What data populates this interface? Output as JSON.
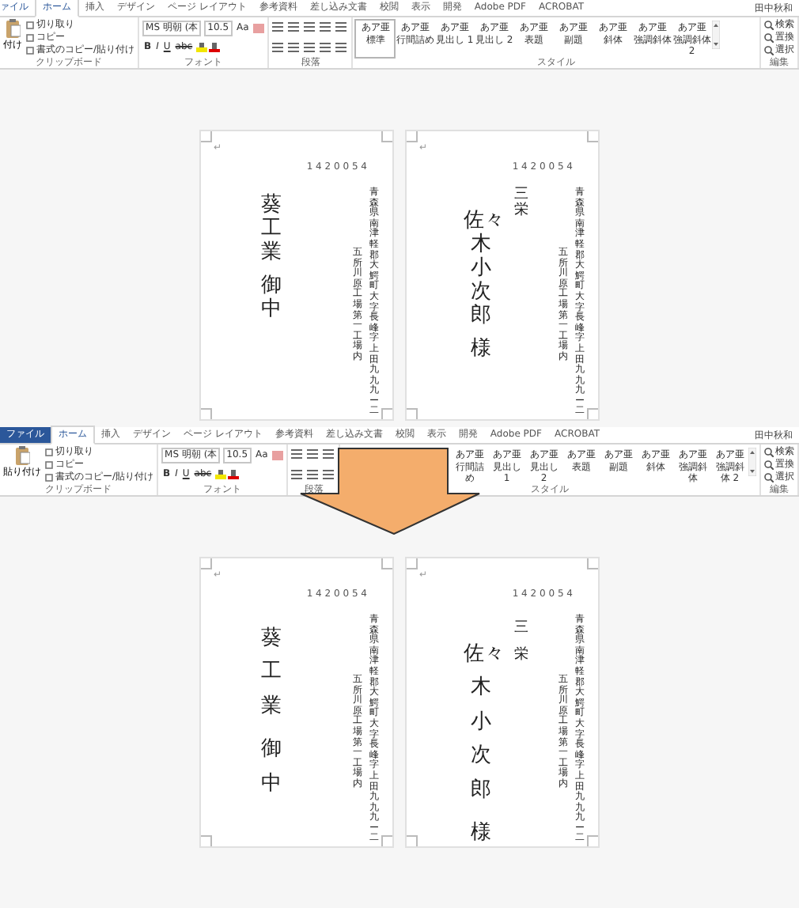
{
  "screens": [
    {
      "ribbon": {
        "tabs": [
          {
            "label": "ァイル",
            "kind": "file",
            "selected": false
          },
          {
            "label": "ホーム",
            "kind": "tab",
            "selected": true
          },
          {
            "label": "挿入",
            "kind": "tab",
            "selected": false
          },
          {
            "label": "デザイン",
            "kind": "tab",
            "selected": false
          },
          {
            "label": "ページ レイアウト",
            "kind": "tab",
            "selected": false
          },
          {
            "label": "参考資料",
            "kind": "tab",
            "selected": false
          },
          {
            "label": "差し込み文書",
            "kind": "tab",
            "selected": false
          },
          {
            "label": "校閲",
            "kind": "tab",
            "selected": false
          },
          {
            "label": "表示",
            "kind": "tab",
            "selected": false
          },
          {
            "label": "開発",
            "kind": "tab",
            "selected": false
          },
          {
            "label": "Adobe PDF",
            "kind": "tab",
            "selected": false
          },
          {
            "label": "ACROBAT",
            "kind": "tab",
            "selected": false
          }
        ],
        "user": "田中秋和",
        "groups": [
          {
            "kind": "clipboard",
            "label": "クリップボード",
            "paste": "付け",
            "items": [
              "切り取り",
              "コピー",
              "書式のコピー/貼り付け"
            ]
          },
          {
            "kind": "font",
            "label": "フォント",
            "font": "MS 明朝 (本",
            "size": "10.5",
            "case": "Aa",
            "formats": [
              "B",
              "I",
              "U",
              "abc"
            ]
          },
          {
            "kind": "paragraph",
            "label": "段落"
          },
          {
            "kind": "styles",
            "label": "スタイル",
            "items": [
              {
                "preview": "あア亜",
                "name": "標準",
                "selected": true
              },
              {
                "preview": "あア亜",
                "name": "行間詰め",
                "selected": false
              },
              {
                "preview": "あア亜",
                "name": "見出し 1",
                "selected": false
              },
              {
                "preview": "あア亜",
                "name": "見出し 2",
                "selected": false
              },
              {
                "preview": "あア亜",
                "name": "表題",
                "selected": false
              },
              {
                "preview": "あア亜",
                "name": "副題",
                "selected": false
              },
              {
                "preview": "あア亜",
                "name": "斜体",
                "selected": false
              },
              {
                "preview": "あア亜",
                "name": "強調斜体",
                "selected": false
              },
              {
                "preview": "あア亜",
                "name": "強調斜体 2",
                "selected": false
              }
            ]
          },
          {
            "kind": "editing",
            "label": "編集",
            "items": [
              "検索",
              "置換",
              "選択"
            ]
          }
        ]
      },
      "pages": [
        {
          "mark": "↵",
          "postal": "1 4 2 0 0 5 4",
          "recipient": {
            "name": "葵工業",
            "honorific": "御中"
          },
          "address": [
            "五所川原工場第一工場内",
            "青森県南津軽郡大鰐町大字長峰字上田九九九ー二"
          ],
          "spaced": false
        },
        {
          "mark": "↵",
          "postal": "1 4 2 0 0 5 4",
          "recipient": {
            "name": "佐々木小次郎",
            "honorific": "様"
          },
          "company": "三栄",
          "address": [
            "五所川原工場第一工場内",
            "青森県南津軽郡大鰐町大字長峰字上田九九九ー二"
          ],
          "spaced": false
        }
      ]
    },
    {
      "ribbon": {
        "tabs": [
          {
            "label": "ファイル",
            "kind": "file",
            "selected": false
          },
          {
            "label": "ホーム",
            "kind": "tab",
            "selected": true
          },
          {
            "label": "挿入",
            "kind": "tab",
            "selected": false
          },
          {
            "label": "デザイン",
            "kind": "tab",
            "selected": false
          },
          {
            "label": "ページ レイアウト",
            "kind": "tab",
            "selected": false
          },
          {
            "label": "参考資料",
            "kind": "tab",
            "selected": false
          },
          {
            "label": "差し込み文書",
            "kind": "tab",
            "selected": false
          },
          {
            "label": "校閲",
            "kind": "tab",
            "selected": false
          },
          {
            "label": "表示",
            "kind": "tab",
            "selected": false
          },
          {
            "label": "開発",
            "kind": "tab",
            "selected": false
          },
          {
            "label": "Adobe PDF",
            "kind": "tab",
            "selected": false
          },
          {
            "label": "ACROBAT",
            "kind": "tab",
            "selected": false
          }
        ],
        "user": "田中秋和",
        "groups": [
          {
            "kind": "clipboard",
            "label": "クリップボード",
            "paste": "貼り付け",
            "items": [
              "切り取り",
              "コピー",
              "書式のコピー/貼り付け"
            ]
          },
          {
            "kind": "font",
            "label": "フォント",
            "font": "MS 明朝 (本",
            "size": "10.5",
            "case": "Aa",
            "formats": [
              "B",
              "I",
              "U",
              "abc"
            ]
          },
          {
            "kind": "paragraph",
            "label": "段落"
          },
          {
            "kind": "styles",
            "label": "スタイル",
            "items": [
              {
                "preview": "あア亜",
                "name": "行間詰め",
                "selected": false
              },
              {
                "preview": "あア亜",
                "name": "見出し 1",
                "selected": false
              },
              {
                "preview": "あア亜",
                "name": "見出し 2",
                "selected": false
              },
              {
                "preview": "あア亜",
                "name": "表題",
                "selected": false
              },
              {
                "preview": "あア亜",
                "name": "副題",
                "selected": false
              },
              {
                "preview": "あア亜",
                "name": "斜体",
                "selected": false
              },
              {
                "preview": "あア亜",
                "name": "強調斜体",
                "selected": false
              },
              {
                "preview": "あア亜",
                "name": "強調斜体 2",
                "selected": false
              }
            ]
          },
          {
            "kind": "editing",
            "label": "編集",
            "items": [
              "検索",
              "置換",
              "選択"
            ]
          }
        ]
      },
      "pages": [
        {
          "mark": "↵",
          "postal": "1 4 2 0 0 5 4",
          "recipient": {
            "name": "葵工業",
            "honorific": "御中"
          },
          "address": [
            "五所川原工場第一工場内",
            "青森県南津軽郡大鰐町大字長峰字上田九九九ー二"
          ],
          "spaced": true
        },
        {
          "mark": "↵",
          "postal": "1 4 2 0 0 5 4",
          "recipient": {
            "name": "佐々木小次郎",
            "honorific": "様"
          },
          "company": "三栄",
          "address": [
            "五所川原工場第一工場内",
            "青森県南津軽郡大鰐町大字長峰字上田九九九ー二"
          ],
          "spaced": true
        }
      ]
    }
  ]
}
